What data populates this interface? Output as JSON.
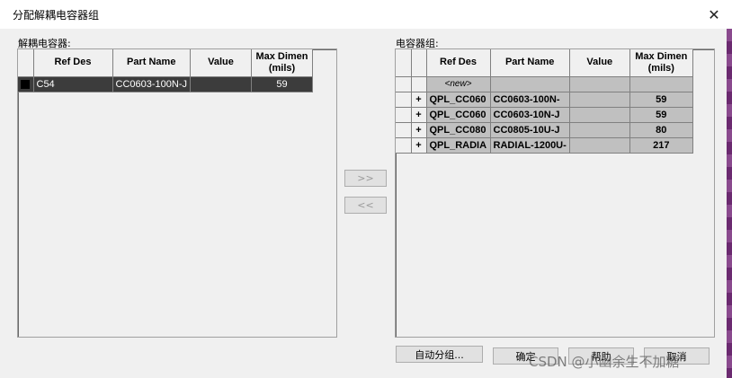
{
  "window": {
    "title": "分配解耦电容器组",
    "close_symbol": "✕"
  },
  "left_panel": {
    "label": "解耦电容器:",
    "columns": [
      "Ref Des",
      "Part Name",
      "Value",
      "Max Dimen (mils)"
    ],
    "rows": [
      {
        "ref_des": "C54",
        "part_name": "CC0603-100N-J",
        "value": "",
        "max_dimen": "59",
        "selected": true
      }
    ]
  },
  "right_panel": {
    "label": "电容器组:",
    "columns": [
      "Ref Des",
      "Part Name",
      "Value",
      "Max Dimen (mils)"
    ],
    "new_row": "<new>",
    "rows": [
      {
        "expand": "+",
        "ref_des": "QPL_CC060",
        "part_name": "CC0603-100N-",
        "value": "",
        "max_dimen": "59"
      },
      {
        "expand": "+",
        "ref_des": "QPL_CC060",
        "part_name": "CC0603-10N-J",
        "value": "",
        "max_dimen": "59"
      },
      {
        "expand": "+",
        "ref_des": "QPL_CC080",
        "part_name": "CC0805-10U-J",
        "value": "",
        "max_dimen": "80"
      },
      {
        "expand": "+",
        "ref_des": "QPL_RADIA",
        "part_name": "RADIAL-1200U-",
        "value": "",
        "max_dimen": "217"
      }
    ]
  },
  "move_buttons": {
    "add_label": ">>",
    "remove_label": "<<"
  },
  "footer": {
    "auto_group_label": "自动分组...",
    "ok_label": "确定",
    "help_label": "帮助",
    "cancel_label": "取消"
  },
  "watermark": "CSDN @小幽余生不加糖"
}
